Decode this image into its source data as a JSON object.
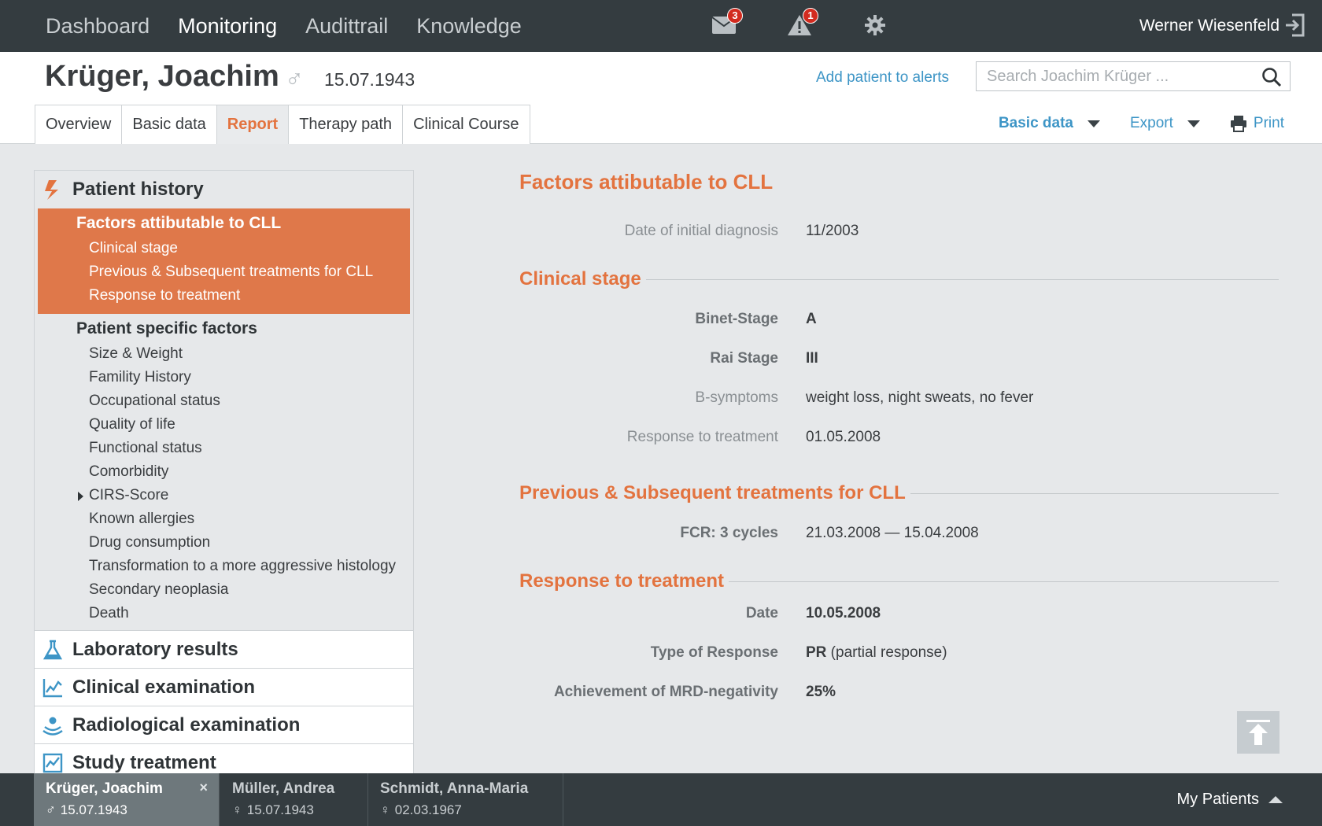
{
  "nav": {
    "items": [
      "Dashboard",
      "Monitoring",
      "Audittrail",
      "Knowledge"
    ],
    "active_index": 1,
    "mail_count": "3",
    "alert_count": "1",
    "user": "Werner Wiesenfeld"
  },
  "patient": {
    "name": "Krüger, Joachim",
    "sex_symbol": "♂",
    "dob": "15.07.1943",
    "add_alert": "Add patient to alerts",
    "search_placeholder": "Search Joachim Krüger ..."
  },
  "tabs": [
    "Overview",
    "Basic data",
    "Report",
    "Therapy path",
    "Clinical Course"
  ],
  "active_tab": "Report",
  "actions": {
    "basic_data": "Basic data",
    "export": "Export",
    "print": "Print"
  },
  "sidebar": {
    "open_section": "Patient history",
    "active_group": {
      "title": "Factors attibutable to CLL",
      "items": [
        "Clinical stage",
        "Previous & Subsequent treatments for CLL",
        "Response to treatment"
      ]
    },
    "plain_group": {
      "title": "Patient specific factors",
      "items": [
        "Size & Weight",
        "Famility History",
        "Occupational status",
        "Quality of life",
        "Functional status",
        "Comorbidity",
        "CIRS-Score",
        "Known allergies",
        "Drug consumption",
        "Transformation to a more aggressive histology",
        "Secondary neoplasia",
        "Death"
      ]
    },
    "closed_sections": [
      "Laboratory results",
      "Clinical examination",
      "Radiological examination",
      "Study treatment"
    ]
  },
  "content": {
    "title": "Factors attibutable to CLL",
    "diagnosis": {
      "label": "Date of initial diagnosis",
      "value": "11/2003"
    },
    "clinical_stage": {
      "title": "Clinical stage",
      "rows": [
        {
          "label": "Binet-Stage",
          "value": "A"
        },
        {
          "label": "Rai Stage",
          "value": "III"
        },
        {
          "label": "B-symptoms",
          "value": "weight loss, night sweats, no fever"
        },
        {
          "label": "Response to treatment",
          "value": "01.05.2008"
        }
      ]
    },
    "treatments": {
      "title": "Previous & Subsequent treatments for CLL",
      "rows": [
        {
          "label": "FCR: 3 cycles",
          "value": "21.03.2008 — 15.04.2008"
        }
      ]
    },
    "response": {
      "title": "Response to treatment",
      "rows": [
        {
          "label": "Date",
          "value": "10.05.2008"
        },
        {
          "label": "Type of Response",
          "value": "PR",
          "value_extra": " (partial response)"
        },
        {
          "label": "Achievement of MRD-negativity",
          "value": "25%"
        }
      ]
    }
  },
  "bottom": {
    "patients": [
      {
        "name": "Krüger, Joachim",
        "sex_symbol": "♂",
        "dob": "15.07.1943"
      },
      {
        "name": "Müller, Andrea",
        "sex_symbol": "♀",
        "dob": "15.07.1943"
      },
      {
        "name": "Schmidt, Anna-Maria",
        "sex_symbol": "♀",
        "dob": "02.03.1967"
      }
    ],
    "close_symbol": "×",
    "my_patients": "My Patients"
  },
  "colors": {
    "accent": "#e3733f",
    "link": "#3d95c6",
    "topbar": "#343c40",
    "background": "#e6e8ea"
  }
}
